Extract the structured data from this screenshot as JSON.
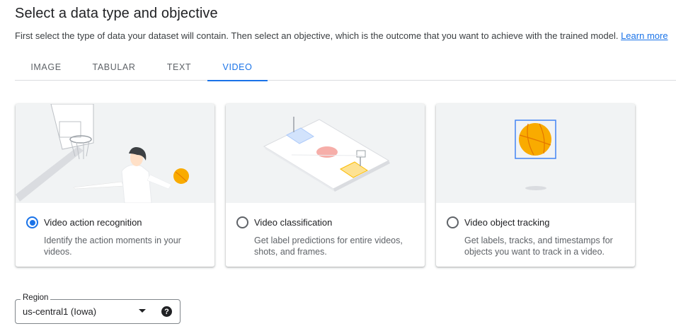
{
  "header": {
    "title": "Select a data type and objective",
    "subtitle": "First select the type of data your dataset will contain. Then select an objective, which is the outcome that you want to achieve with the trained model.",
    "learn_more": "Learn more"
  },
  "tabs": [
    {
      "label": "IMAGE",
      "active": false
    },
    {
      "label": "TABULAR",
      "active": false
    },
    {
      "label": "TEXT",
      "active": false
    },
    {
      "label": "VIDEO",
      "active": true
    }
  ],
  "cards": [
    {
      "title": "Video action recognition",
      "description": "Identify the action moments in your videos.",
      "selected": true,
      "illustration": "basketball-player-icon"
    },
    {
      "title": "Video classification",
      "description": "Get label predictions for entire videos, shots, and frames.",
      "selected": false,
      "illustration": "basketball-court-icon"
    },
    {
      "title": "Video object tracking",
      "description": "Get labels, tracks, and timestamps for objects you want to track in a video.",
      "selected": false,
      "illustration": "tracked-ball-icon"
    }
  ],
  "region": {
    "label": "Region",
    "value": "us-central1 (Iowa)",
    "help_icon": "?"
  },
  "colors": {
    "accent": "#1a73e8",
    "ball": "#f9ab00",
    "card_image_bg": "#f1f3f4"
  }
}
